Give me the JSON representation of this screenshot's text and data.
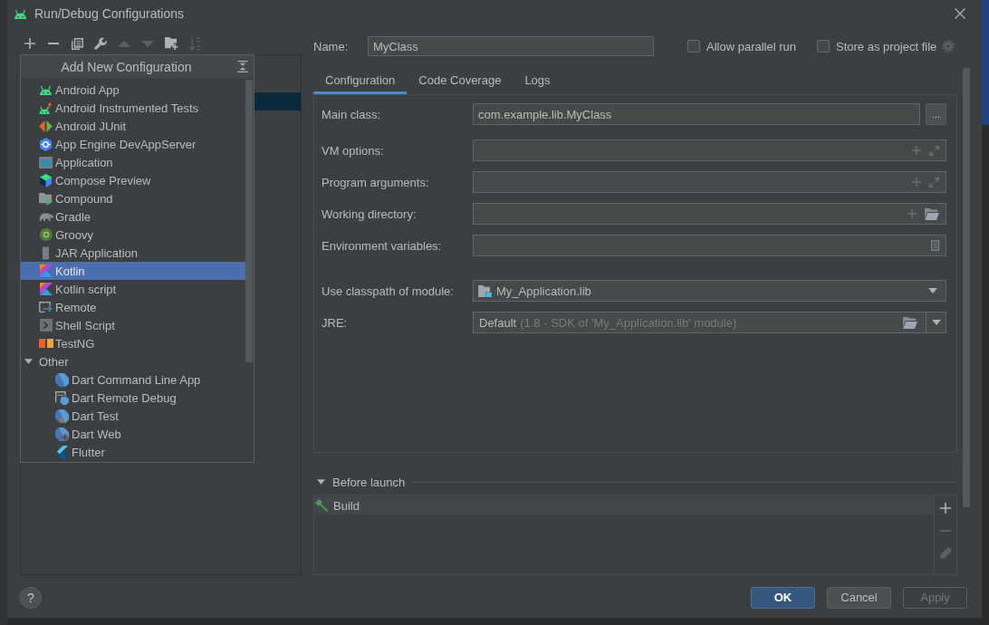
{
  "window": {
    "title": "Run/Debug Configurations"
  },
  "toolbar": [
    {
      "kind": "add",
      "disabled": false
    },
    {
      "kind": "remove",
      "disabled": false
    },
    {
      "kind": "copy",
      "disabled": false
    },
    {
      "kind": "wrench",
      "disabled": false
    },
    {
      "kind": "up",
      "disabled": true
    },
    {
      "kind": "down",
      "disabled": true
    },
    {
      "kind": "folder-add",
      "disabled": false
    },
    {
      "kind": "sort",
      "disabled": true
    }
  ],
  "config_tree": {
    "rows": [
      {
        "selected": true
      }
    ]
  },
  "popup": {
    "title": "Add New Configuration",
    "items": [
      {
        "label": "Android App",
        "kind": "android",
        "selected": false
      },
      {
        "label": "Android Instrumented Tests",
        "kind": "android-test",
        "selected": false
      },
      {
        "label": "Android JUnit",
        "kind": "junit",
        "selected": false
      },
      {
        "label": "App Engine DevAppServer",
        "kind": "appengine",
        "selected": false
      },
      {
        "label": "Application",
        "kind": "application",
        "selected": false
      },
      {
        "label": "Compose Preview",
        "kind": "compose",
        "selected": false
      },
      {
        "label": "Compound",
        "kind": "compound",
        "selected": false
      },
      {
        "label": "Gradle",
        "kind": "gradle",
        "selected": false
      },
      {
        "label": "Groovy",
        "kind": "groovy",
        "selected": false
      },
      {
        "label": "JAR Application",
        "kind": "jar",
        "selected": false
      },
      {
        "label": "Kotlin",
        "kind": "kotlin",
        "selected": true
      },
      {
        "label": "Kotlin script",
        "kind": "kotlin",
        "selected": false
      },
      {
        "label": "Remote",
        "kind": "remote",
        "selected": false
      },
      {
        "label": "Shell Script",
        "kind": "shell",
        "selected": false
      },
      {
        "label": "TestNG",
        "kind": "testng",
        "selected": false
      },
      {
        "label": "Other",
        "kind": "group",
        "selected": false,
        "expanded": true,
        "children": [
          {
            "label": "Dart Command Line App",
            "kind": "dart",
            "selected": false
          },
          {
            "label": "Dart Remote Debug",
            "kind": "dart-remote",
            "selected": false
          },
          {
            "label": "Dart Test",
            "kind": "dart-test",
            "selected": false
          },
          {
            "label": "Dart Web",
            "kind": "dart-web",
            "selected": false
          },
          {
            "label": "Flutter",
            "kind": "flutter",
            "selected": false
          }
        ]
      }
    ]
  },
  "name": {
    "label": "Name:",
    "value": "MyClass"
  },
  "options": [
    {
      "label": "Allow parallel run",
      "checked": false
    },
    {
      "label": "Store as project file",
      "checked": false
    }
  ],
  "tabs": [
    {
      "label": "Configuration",
      "selected": true
    },
    {
      "label": "Code Coverage",
      "selected": false
    },
    {
      "label": "Logs",
      "selected": false
    }
  ],
  "fields": [
    {
      "label": "Main class:",
      "kind": "browse",
      "value": "com.example.lib.MyClass",
      "button": "..."
    },
    {
      "label": "VM options:",
      "kind": "expand"
    },
    {
      "label": "Program arguments:",
      "kind": "expand"
    },
    {
      "label": "Working directory:",
      "kind": "folder"
    },
    {
      "label": "Environment variables:",
      "kind": "env"
    },
    {
      "label": "Use classpath of module:",
      "kind": "module",
      "value": "My_Application.lib"
    },
    {
      "label": "JRE:",
      "kind": "jre",
      "value": "Default",
      "hint": "(1.8 - SDK of 'My_Application.lib' module)"
    }
  ],
  "before_launch": {
    "title": "Before launch",
    "expanded": true,
    "tasks": [
      {
        "label": "Build",
        "kind": "build",
        "selected": true
      }
    ],
    "tools": [
      {
        "kind": "add",
        "disabled": false
      },
      {
        "kind": "remove",
        "disabled": true
      },
      {
        "kind": "edit",
        "disabled": true
      }
    ]
  },
  "help_button": "?",
  "buttons": [
    {
      "label": "OK",
      "kind": "primary",
      "disabled": false
    },
    {
      "label": "Cancel",
      "kind": "secondary",
      "disabled": false
    },
    {
      "label": "Apply",
      "kind": "secondary",
      "disabled": true
    }
  ]
}
